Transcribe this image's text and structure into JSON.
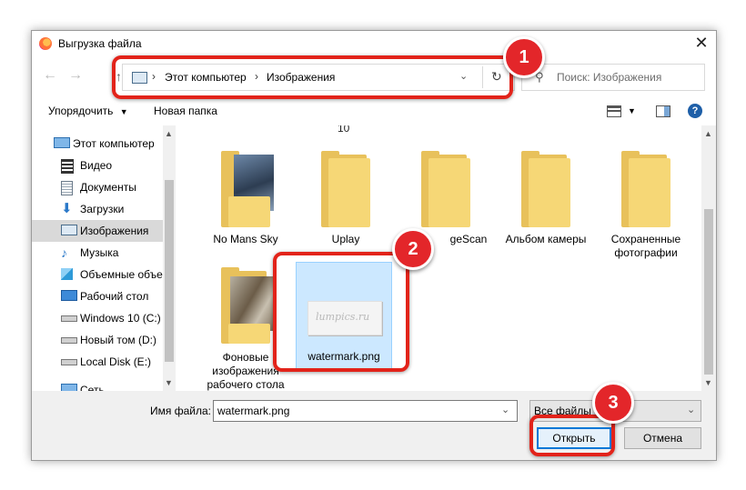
{
  "window": {
    "title": "Выгрузка файла"
  },
  "address": {
    "crumbs": [
      "Этот компьютер",
      "Изображения"
    ],
    "search_placeholder": "Поиск: Изображения"
  },
  "toolbar": {
    "organize": "Упорядочить",
    "new_folder": "Новая папка"
  },
  "sidebar": {
    "items": [
      {
        "label": "Этот компьютер",
        "icon": "computer-icon"
      },
      {
        "label": "Видео",
        "icon": "video-icon"
      },
      {
        "label": "Документы",
        "icon": "documents-icon"
      },
      {
        "label": "Загрузки",
        "icon": "downloads-icon"
      },
      {
        "label": "Изображения",
        "icon": "pictures-icon",
        "selected": true
      },
      {
        "label": "Музыка",
        "icon": "music-icon"
      },
      {
        "label": "Объемные объе",
        "icon": "3d-objects-icon"
      },
      {
        "label": "Рабочий стол",
        "icon": "desktop-icon"
      },
      {
        "label": "Windows 10 (C:)",
        "icon": "drive-icon"
      },
      {
        "label": "Новый том (D:)",
        "icon": "drive-icon"
      },
      {
        "label": "Local Disk (E:)",
        "icon": "drive-icon"
      },
      {
        "label": "Сеть",
        "icon": "network-icon"
      }
    ]
  },
  "files": {
    "top_cut_label": "10",
    "items": [
      {
        "name": "No Mans Sky",
        "type": "folder-with-image"
      },
      {
        "name": "Uplay",
        "type": "folder"
      },
      {
        "name": "geScan",
        "type": "folder"
      },
      {
        "name": "Альбом камеры",
        "type": "folder"
      },
      {
        "name": "Сохраненные фотографии",
        "type": "folder"
      },
      {
        "name": "Фоновые изображения рабочего стола",
        "type": "folder-with-image"
      },
      {
        "name": "watermark.png",
        "type": "image",
        "thumb_text": "lumpics.ru"
      }
    ]
  },
  "bottom": {
    "filename_label": "Имя файла:",
    "filename_value": "watermark.png",
    "filetype_value": "Все файлы",
    "open_label": "Открыть",
    "cancel_label": "Отмена"
  },
  "annotations": [
    "1",
    "2",
    "3"
  ],
  "colors": {
    "highlight": "#e2231a",
    "selection": "#cce8ff",
    "primary_border": "#0078d7",
    "folder": "#f6d776"
  }
}
